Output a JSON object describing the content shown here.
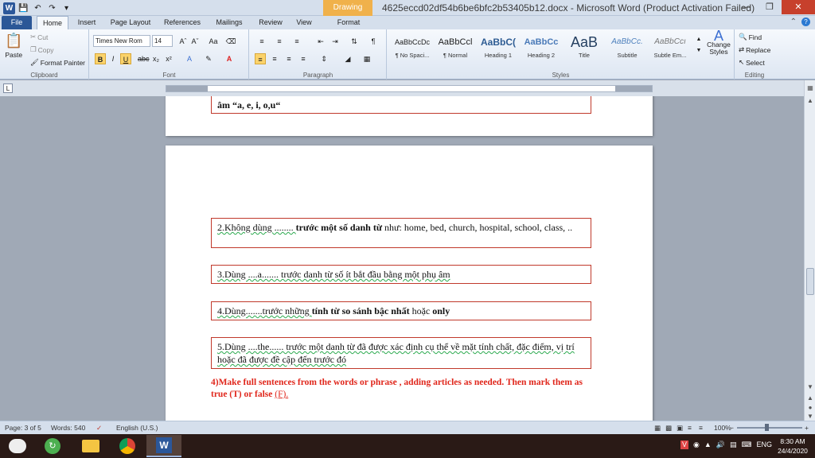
{
  "titlebar": {
    "context_tab": "Drawing Tools",
    "document_title": "4625eccd02df54b6be6bfc2b53405b12.docx - Microsoft Word (Product Activation Failed)"
  },
  "tabs": [
    "File",
    "Home",
    "Insert",
    "Page Layout",
    "References",
    "Mailings",
    "Review",
    "View",
    "Format"
  ],
  "ribbon": {
    "clipboard": {
      "paste": "Paste",
      "cut": "Cut",
      "copy": "Copy",
      "format_painter": "Format Painter",
      "label": "Clipboard"
    },
    "font": {
      "name": "Times New Rom",
      "size": "14",
      "label": "Font"
    },
    "paragraph": {
      "label": "Paragraph"
    },
    "styles": {
      "label": "Styles",
      "items": [
        {
          "preview": "AaBbCcDc",
          "name": "¶ No Spaci..."
        },
        {
          "preview": "AaBbCcl",
          "name": "¶ Normal"
        },
        {
          "preview": "AaBbC(",
          "name": "Heading 1"
        },
        {
          "preview": "AaBbCc",
          "name": "Heading 2"
        },
        {
          "preview": "AaB",
          "name": "Title"
        },
        {
          "preview": "AaBbCc.",
          "name": "Subtitle"
        },
        {
          "preview": "AaBbCcı",
          "name": "Subtle Em..."
        }
      ],
      "change_styles": "Change Styles"
    },
    "editing": {
      "find": "Find",
      "replace": "Replace",
      "select": "Select",
      "label": "Editing"
    }
  },
  "document": {
    "page1_box": "âm “a, e, i, o,u“",
    "box2_prefix": "2.Không dùng ........ ",
    "box2_bold": "trước một số danh từ",
    "box2_suffix": " như:  home, bed, church, hospital, school, class, ..",
    "box3": "3.Dùng ....a....... trước danh từ số ít bắt đầu bằng một phụ âm",
    "box4_prefix": "4.Dùng.......trước những ",
    "box4_bold": "tính từ so sánh bậc nhất",
    "box4_mid": " hoặc ",
    "box4_bold2": "only",
    "box5": "5.Dùng ....the...... trước một danh từ đã được xác định cụ thể về mặt tính chất, đặc điểm, vị trí hoặc đã được đề cập đến trước đó",
    "heading": "4)Make full sentences from the words or phrase , adding articles as needed. Then mark them as true (T) or false ",
    "heading_tail": "(F)."
  },
  "status": {
    "page": "Page: 3 of 5",
    "words": "Words: 540",
    "language": "English (U.S.)",
    "zoom": "100%"
  },
  "taskbar": {
    "lang": "ENG",
    "time": "8:30 AM",
    "date": "24/4/2020"
  },
  "colors": {
    "accent": "#2b579a",
    "box_border": "#c0392b",
    "heading_red": "#e0261b",
    "taskbar": "#2a1a16"
  }
}
